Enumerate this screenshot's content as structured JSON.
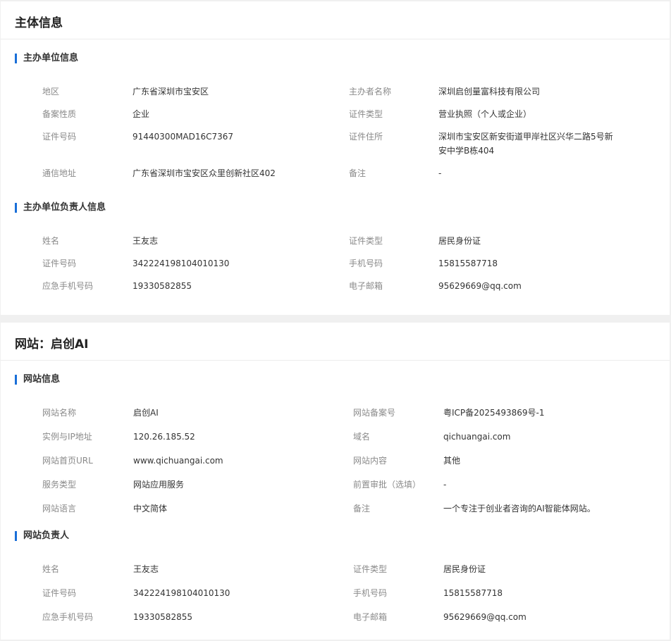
{
  "subject": {
    "title": "主体信息",
    "org_section_title": "主办单位信息",
    "org_rows": [
      {
        "l1": "地区",
        "v1": "广东省深圳市宝安区",
        "l2": "主办者名称",
        "v2": "深圳启创量富科技有限公司"
      },
      {
        "l1": "备案性质",
        "v1": "企业",
        "l2": "证件类型",
        "v2": "营业执照（个人或企业）"
      },
      {
        "l1": "证件号码",
        "v1": "91440300MAD16C7367",
        "l2": "证件住所",
        "v2": "深圳市宝安区新安街道甲岸社区兴华二路5号新安中学B栋404"
      },
      {
        "l1": "通信地址",
        "v1": "广东省深圳市宝安区众里创新社区402",
        "l2": "备注",
        "v2": "-"
      }
    ],
    "person_section_title": "主办单位负责人信息",
    "person_rows": [
      {
        "l1": "姓名",
        "v1": "王友志",
        "l2": "证件类型",
        "v2": "居民身份证"
      },
      {
        "l1": "证件号码",
        "v1": "342224198104010130",
        "l2": "手机号码",
        "v2": "15815587718"
      },
      {
        "l1": "应急手机号码",
        "v1": "19330582855",
        "l2": "电子邮箱",
        "v2": "95629669@qq.com"
      }
    ]
  },
  "website": {
    "title": "网站：启创AI",
    "info_section_title": "网站信息",
    "info_rows": [
      {
        "l1": "网站名称",
        "v1": "启创AI",
        "l2": "网站备案号",
        "v2": "粤ICP备2025493869号-1"
      },
      {
        "l1": "实例与IP地址",
        "v1": "120.26.185.52",
        "l2": "域名",
        "v2": "qichuangai.com"
      },
      {
        "l1": "网站首页URL",
        "v1": "www.qichuangai.com",
        "l2": "网站内容",
        "v2": "其他"
      },
      {
        "l1": "服务类型",
        "v1": "网站应用服务",
        "l2": "前置审批（选填）",
        "v2": "-"
      },
      {
        "l1": "网站语言",
        "v1": "中文简体",
        "l2": "备注",
        "v2": "一个专注于创业者咨询的AI智能体网站。"
      }
    ],
    "person_section_title": "网站负责人",
    "person_rows": [
      {
        "l1": "姓名",
        "v1": "王友志",
        "l2": "证件类型",
        "v2": "居民身份证"
      },
      {
        "l1": "证件号码",
        "v1": "342224198104010130",
        "l2": "手机号码",
        "v2": "15815587718"
      },
      {
        "l1": "应急手机号码",
        "v1": "19330582855",
        "l2": "电子邮箱",
        "v2": "95629669@qq.com"
      }
    ]
  },
  "colors": {
    "accent": "#1a6fd8",
    "label": "#8a8a8a",
    "value": "#333333",
    "divider": "#ececec",
    "background": "#f0f0f0"
  }
}
